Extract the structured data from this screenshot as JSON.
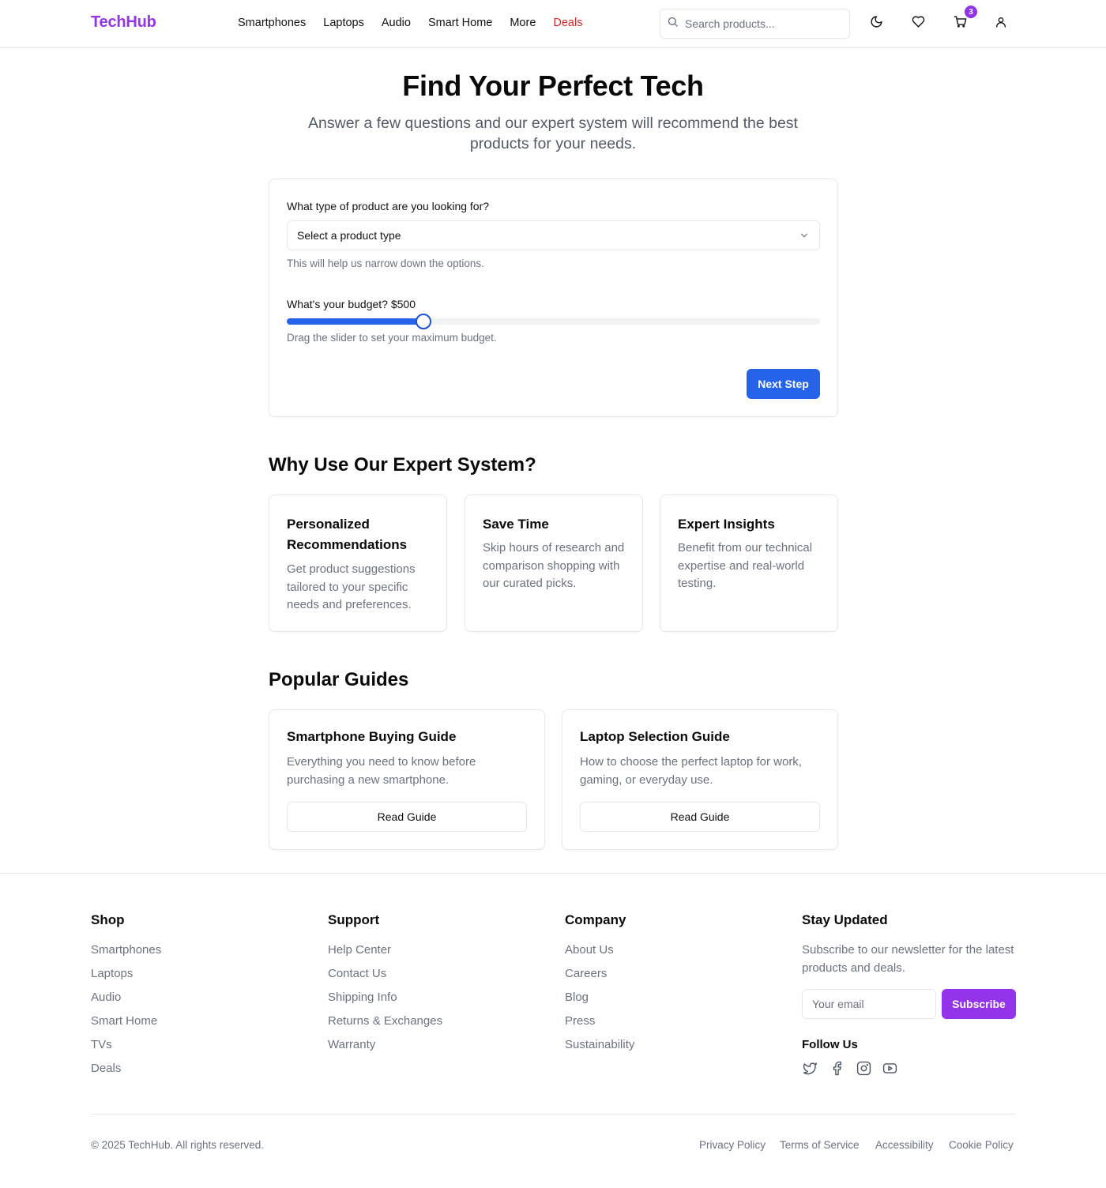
{
  "header": {
    "logo": "TechHub",
    "nav": [
      "Smartphones",
      "Laptops",
      "Audio",
      "Smart Home",
      "More",
      "Deals"
    ],
    "search_placeholder": "Search products...",
    "cart_count": "3"
  },
  "hero": {
    "title": "Find Your Perfect Tech",
    "subtitle": "Answer a few questions and our expert system will recommend the best products for your needs."
  },
  "form": {
    "product_type_label": "What type of product are you looking for?",
    "product_type_value": "Select a product type",
    "product_type_help": "This will help us narrow down the options.",
    "budget_label": "What's your budget? $500",
    "budget_fraction": 0.257,
    "budget_help": "Drag the slider to set your maximum budget.",
    "next_button": "Next Step"
  },
  "why": {
    "title": "Why Use Our Expert System?",
    "cards": [
      {
        "title": "Personalized Recommendations",
        "desc": "Get product suggestions tailored to your specific needs and preferences."
      },
      {
        "title": "Save Time",
        "desc": "Skip hours of research and comparison shopping with our curated picks."
      },
      {
        "title": "Expert Insights",
        "desc": "Benefit from our technical expertise and real-world testing."
      }
    ]
  },
  "guides": {
    "title": "Popular Guides",
    "items": [
      {
        "title": "Smartphone Buying Guide",
        "desc": "Everything you need to know before purchasing a new smartphone.",
        "button": "Read Guide"
      },
      {
        "title": "Laptop Selection Guide",
        "desc": "How to choose the perfect laptop for work, gaming, or everyday use.",
        "button": "Read Guide"
      }
    ]
  },
  "footer": {
    "shop": {
      "title": "Shop",
      "links": [
        "Smartphones",
        "Laptops",
        "Audio",
        "Smart Home",
        "TVs",
        "Deals"
      ]
    },
    "support": {
      "title": "Support",
      "links": [
        "Help Center",
        "Contact Us",
        "Shipping Info",
        "Returns & Exchanges",
        "Warranty"
      ]
    },
    "company": {
      "title": "Company",
      "links": [
        "About Us",
        "Careers",
        "Blog",
        "Press",
        "Sustainability"
      ]
    },
    "newsletter": {
      "title": "Stay Updated",
      "desc": "Subscribe to our newsletter for the latest products and deals.",
      "email_placeholder": "Your email",
      "button": "Subscribe",
      "follow": "Follow Us",
      "socials": [
        "twitter-icon",
        "facebook-icon",
        "instagram-icon",
        "youtube-icon"
      ]
    },
    "copyright": "© 2025 TechHub. All rights reserved.",
    "legal": [
      "Privacy Policy",
      "Terms of Service",
      "Accessibility",
      "Cookie Policy"
    ]
  },
  "colors": {
    "brand": "#9333ea",
    "primary": "#2563eb",
    "deals": "#dc2626"
  }
}
